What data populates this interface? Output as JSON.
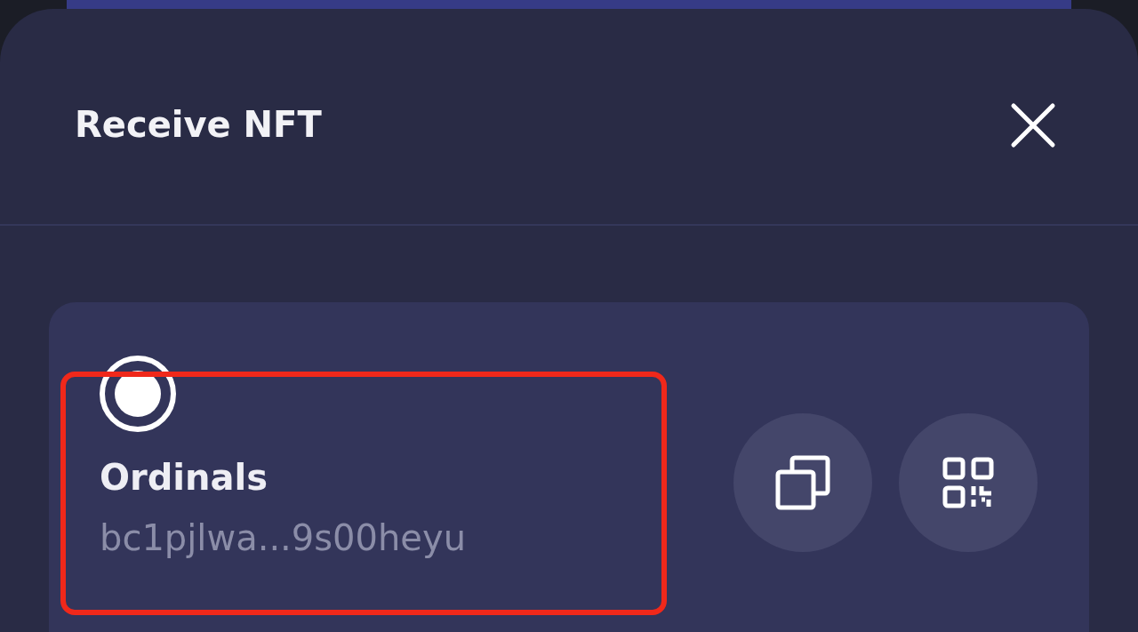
{
  "dialog": {
    "title": "Receive NFT"
  },
  "account": {
    "selected": true,
    "name": "Ordinals",
    "address": "bc1pjlwa...9s00heyu",
    "highlighted": true
  }
}
